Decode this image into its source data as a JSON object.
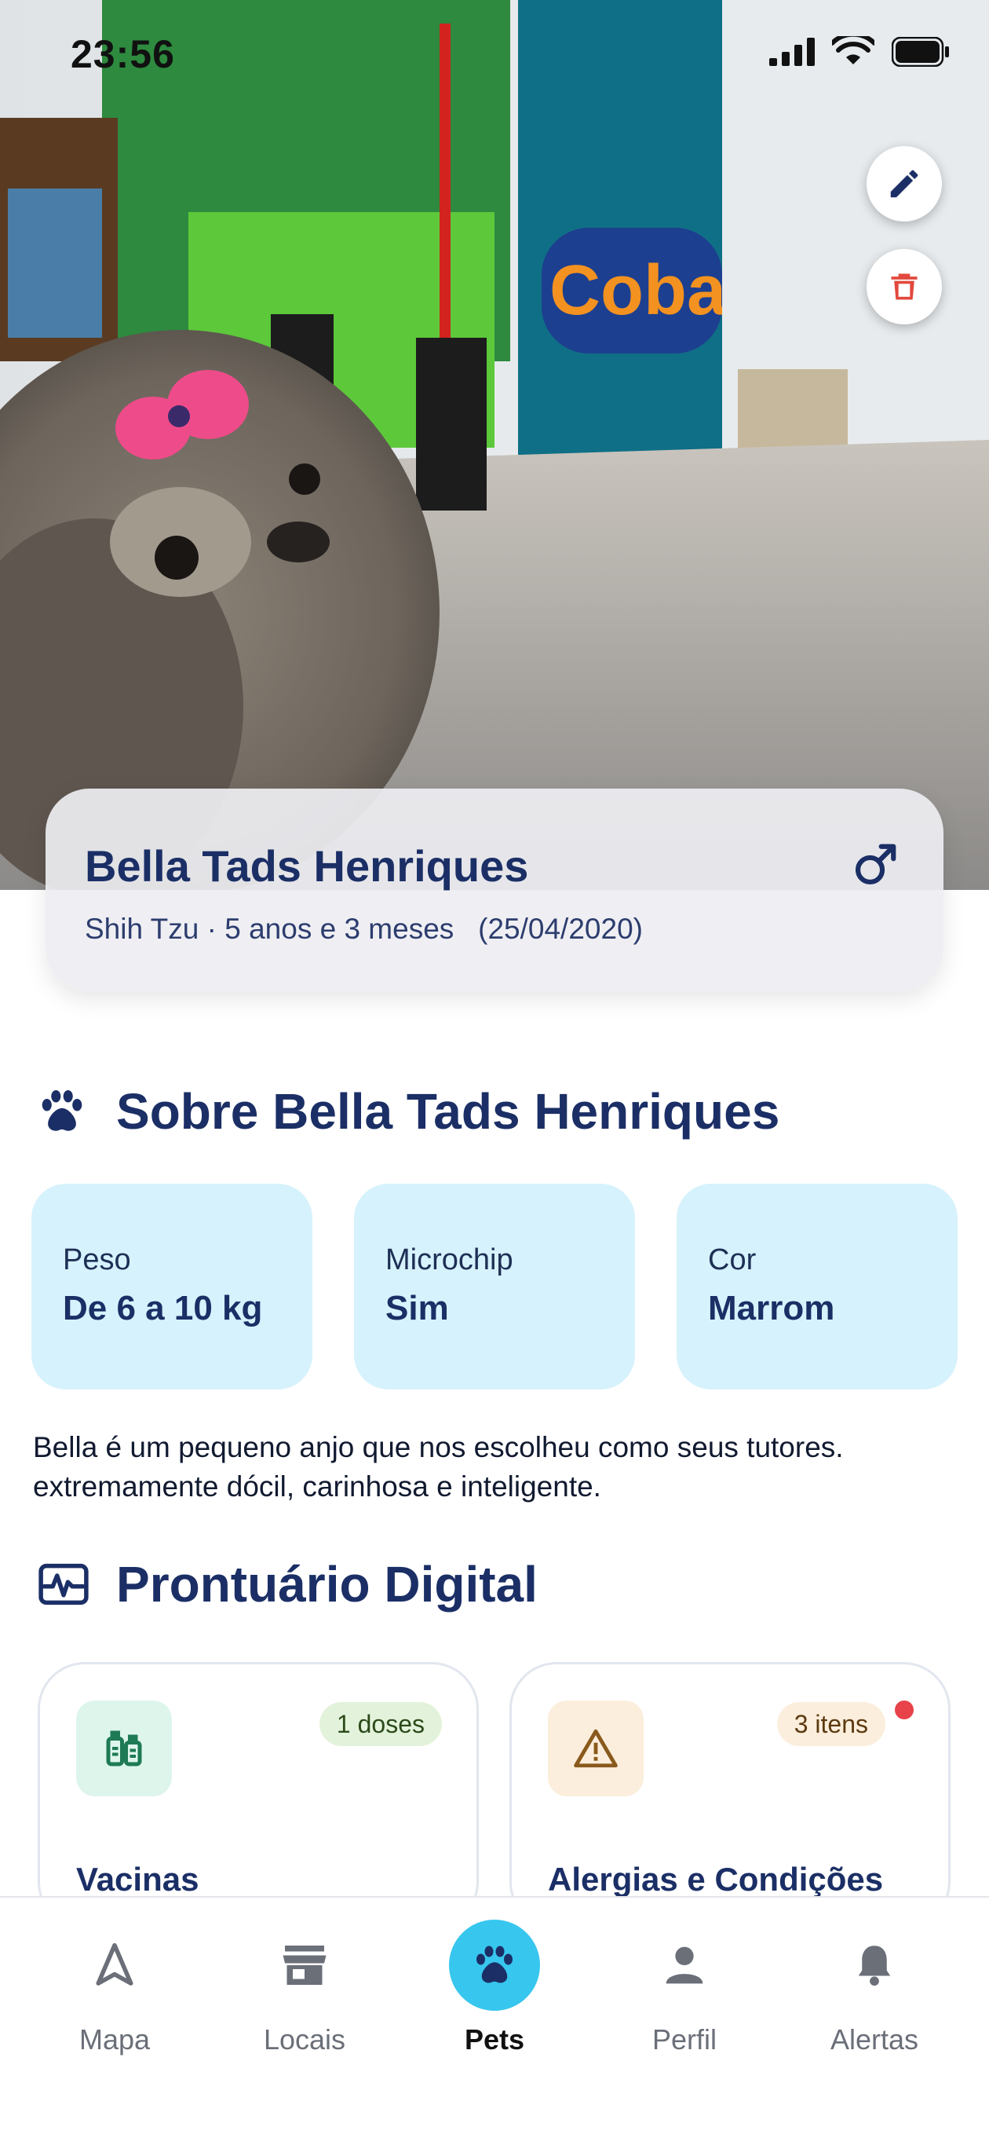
{
  "status_bar": {
    "time": "23:56"
  },
  "pet": {
    "name": "Bella Tads Henriques",
    "breed_age": "Shih Tzu · 5 anos e 3 meses",
    "birth_date": "(25/04/2020)"
  },
  "about": {
    "title": "Sobre Bella Tads Henriques",
    "tiles": [
      {
        "label": "Peso",
        "value": "De 6 a 10 kg"
      },
      {
        "label": "Microchip",
        "value": "Sim"
      },
      {
        "label": "Cor",
        "value": "Marrom"
      }
    ],
    "description": "Bella é um pequeno anjo que nos escolheu como seus tutores. extremamente dócil, carinhosa e inteligente."
  },
  "records": {
    "title": "Prontuário Digital",
    "cards": [
      {
        "title": "Vacinas",
        "badge": "1 doses",
        "icon": "vaccine-icon"
      },
      {
        "title": "Alergias e Condições",
        "badge": "3 itens",
        "icon": "warning-icon"
      }
    ]
  },
  "nav": {
    "items": [
      {
        "label": "Mapa",
        "icon": "navigation-arrow-icon"
      },
      {
        "label": "Locais",
        "icon": "store-icon"
      },
      {
        "label": "Pets",
        "icon": "paw-icon",
        "active": true
      },
      {
        "label": "Perfil",
        "icon": "person-icon"
      },
      {
        "label": "Alertas",
        "icon": "bell-icon"
      }
    ]
  },
  "colors": {
    "primary_text": "#1b2f66",
    "tile_bg": "#d6f2fc",
    "active_nav": "#37c6ee",
    "delete": "#e2483d",
    "alert_dot": "#e8424a"
  }
}
